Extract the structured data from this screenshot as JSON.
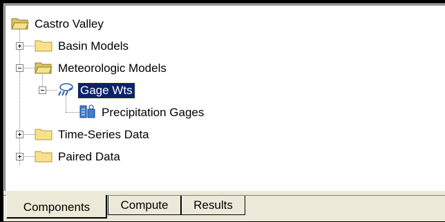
{
  "tree": {
    "root": {
      "label": "Castro Valley",
      "icon": "open-folder-icon"
    },
    "items": [
      {
        "label": "Basin Models",
        "icon": "folder-icon",
        "expander": "+"
      },
      {
        "label": "Meteorologic Models",
        "icon": "open-folder-icon",
        "expander": "-"
      },
      {
        "label": "Gage Wts",
        "icon": "meteorologic-model-icon",
        "expander": "-",
        "selected": true
      },
      {
        "label": "Precipitation Gages",
        "icon": "precipitation-gages-icon"
      },
      {
        "label": "Time-Series Data",
        "icon": "folder-icon",
        "expander": "+"
      },
      {
        "label": "Paired Data",
        "icon": "folder-icon",
        "expander": "+"
      }
    ]
  },
  "tabs": [
    {
      "label": "Components",
      "active": true
    },
    {
      "label": "Compute",
      "active": false
    },
    {
      "label": "Results",
      "active": false
    }
  ],
  "colors": {
    "selection": "#0a246a",
    "folder": "#f7e28b",
    "panel": "#ece9d8"
  }
}
